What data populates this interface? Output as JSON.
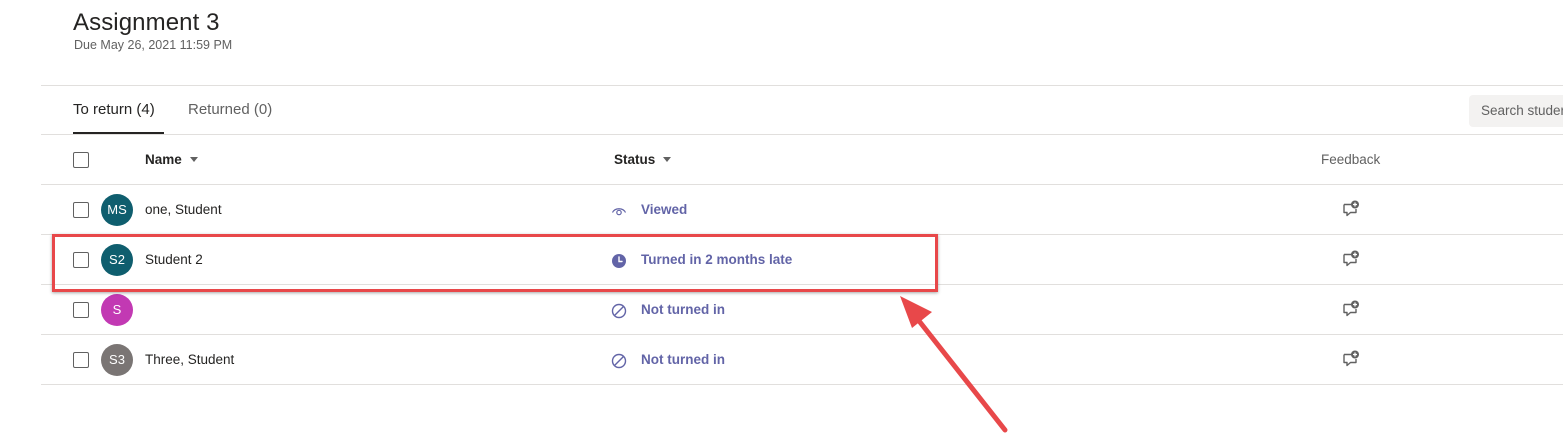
{
  "assignment": {
    "title": "Assignment 3",
    "due": "Due May 26, 2021 11:59 PM"
  },
  "tabs": [
    {
      "label": "To return (4)",
      "active": true
    },
    {
      "label": "Returned (0)",
      "active": false
    }
  ],
  "search": {
    "placeholder": "Search studer"
  },
  "columns": {
    "name": "Name",
    "status": "Status",
    "feedback": "Feedback"
  },
  "students": [
    {
      "initials": "MS",
      "avatar_color": "#0f5e6e",
      "name": "one, Student",
      "status": "Viewed",
      "status_icon": "eye-icon"
    },
    {
      "initials": "S2",
      "avatar_color": "#0f5e6e",
      "name": "Student 2",
      "status": "Turned in 2 months late",
      "status_icon": "clock-icon"
    },
    {
      "initials": "S",
      "avatar_color": "#c239b3",
      "name": "",
      "status": "Not turned in",
      "status_icon": "not-submitted-icon"
    },
    {
      "initials": "S3",
      "avatar_color": "#7a7574",
      "name": "Three, Student",
      "status": "Not turned in",
      "status_icon": "not-submitted-icon"
    }
  ],
  "colors": {
    "accent": "#6264a7",
    "annotation": "#e8484a"
  }
}
